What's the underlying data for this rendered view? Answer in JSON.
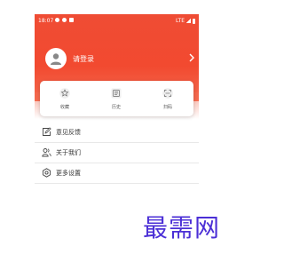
{
  "status_bar": {
    "time": "18:07",
    "network": "LTE"
  },
  "profile": {
    "login_label": "请登录"
  },
  "quick_actions": [
    {
      "label": "收藏",
      "icon": "star-icon"
    },
    {
      "label": "历史",
      "icon": "history-icon"
    },
    {
      "label": "扫码",
      "icon": "scan-icon"
    }
  ],
  "menu": [
    {
      "label": "意见反馈",
      "icon": "feedback-edit-icon"
    },
    {
      "label": "关于我们",
      "icon": "users-icon"
    },
    {
      "label": "更多设置",
      "icon": "gear-icon"
    }
  ],
  "watermark": {
    "text": "最需网"
  },
  "colors": {
    "accent": "#f24a30",
    "watermark": "#4b2fd6"
  }
}
